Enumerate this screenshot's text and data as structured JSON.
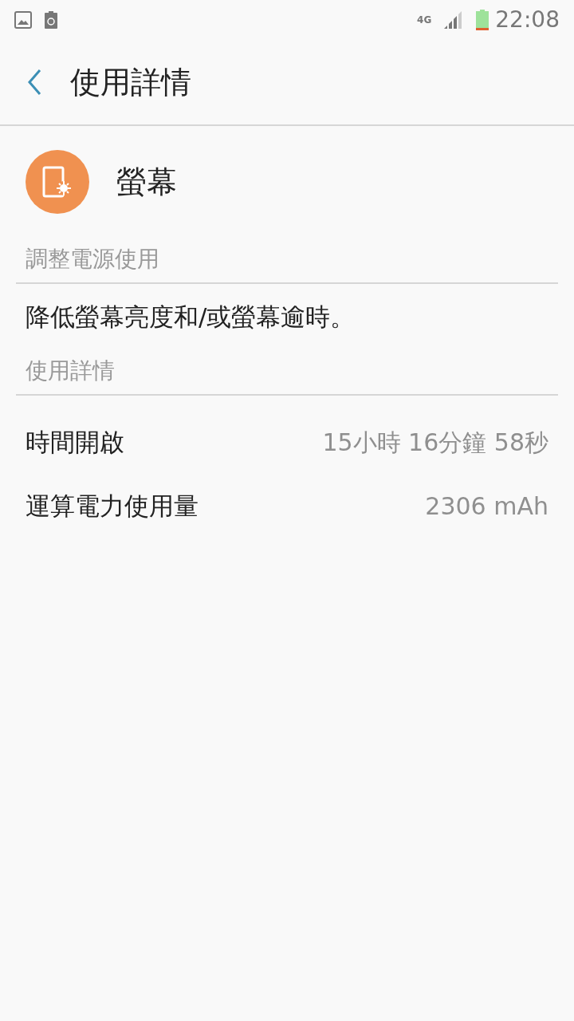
{
  "status_bar": {
    "network": "4G",
    "time": "22:08"
  },
  "app_bar": {
    "title": "使用詳情"
  },
  "app": {
    "name": "螢幕"
  },
  "sections": [
    {
      "header": "調整電源使用",
      "kind": "text",
      "text": "降低螢幕亮度和/或螢幕逾時。"
    },
    {
      "header": "使用詳情",
      "kind": "rows",
      "rows": [
        {
          "label": "時間開啟",
          "value": "15小時 16分鐘 58秒"
        },
        {
          "label": "運算電力使用量",
          "value": "2306 mAh"
        }
      ]
    }
  ]
}
